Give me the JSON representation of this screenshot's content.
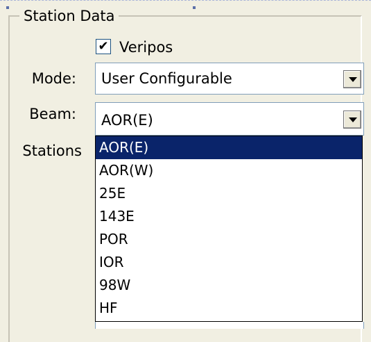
{
  "group": {
    "title": "Station Data"
  },
  "veripos": {
    "label": "Veripos",
    "checked": "✔"
  },
  "mode": {
    "label": "Mode:",
    "value": "User Configurable"
  },
  "beam": {
    "label": "Beam:",
    "value": "AOR(E)"
  },
  "stations": {
    "label": "Stations"
  },
  "beam_options": [
    "AOR(E)",
    "AOR(W)",
    "25E",
    "143E",
    "POR",
    "IOR",
    "98W",
    "HF"
  ],
  "selected_index": 0,
  "colors": {
    "selection": "#0a246a",
    "panel": "#f1efe2"
  }
}
